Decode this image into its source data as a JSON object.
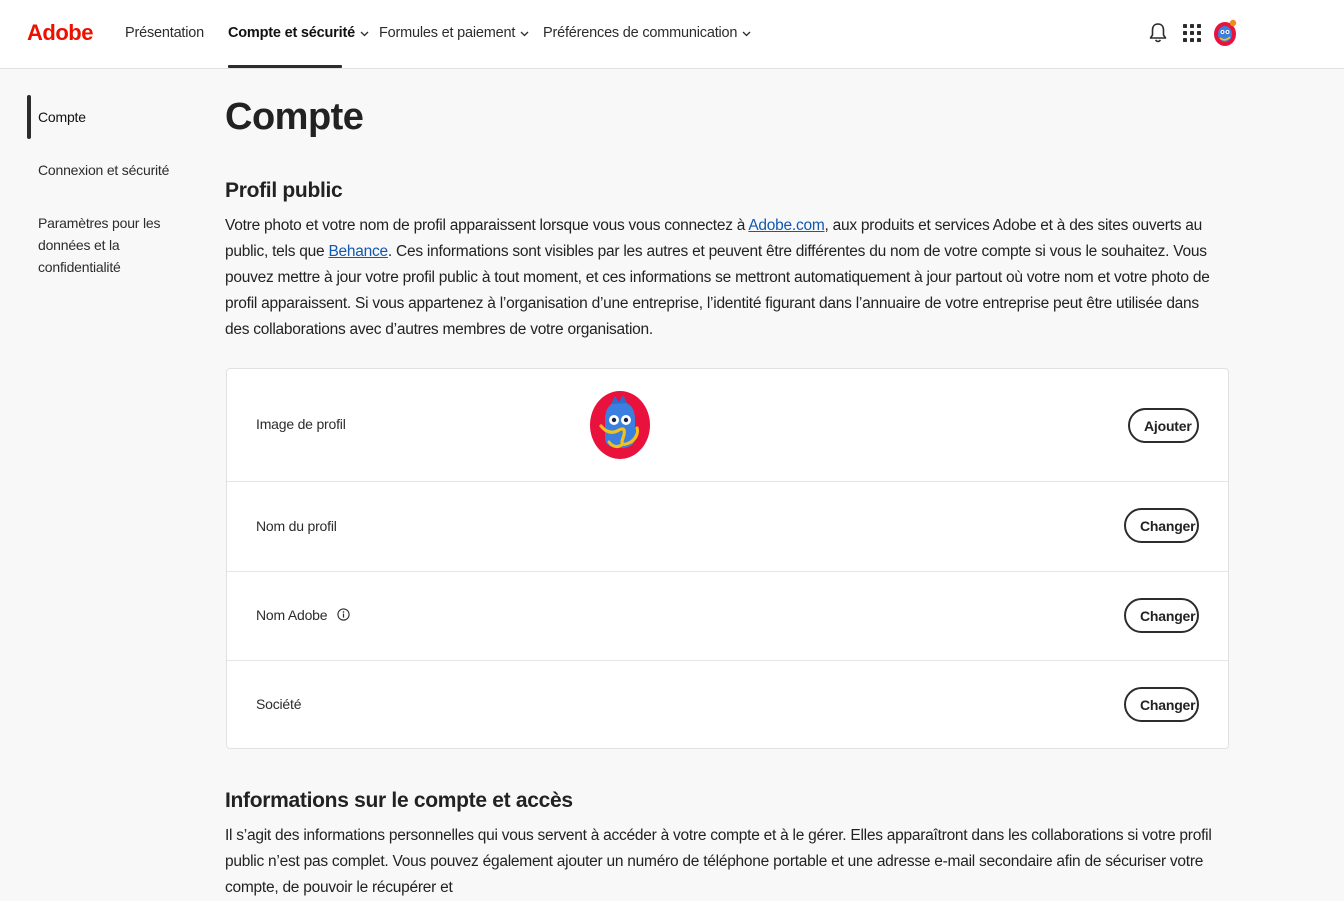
{
  "header": {
    "logo": "Adobe",
    "nav": [
      {
        "label": "Présentation",
        "active": false,
        "has_dropdown": false
      },
      {
        "label": "Compte et sécurité",
        "active": true,
        "has_dropdown": true
      },
      {
        "label": "Formules et paiement",
        "active": false,
        "has_dropdown": true
      },
      {
        "label": "Préférences de communication",
        "active": false,
        "has_dropdown": true
      }
    ],
    "icons": [
      "bell-icon",
      "apps-grid-icon",
      "user-avatar"
    ]
  },
  "sidebar": {
    "items": [
      {
        "label": "Compte",
        "active": true
      },
      {
        "label": "Connexion et sécurité",
        "active": false
      },
      {
        "label": "Paramètres pour les données et la confidentialité",
        "active": false
      }
    ]
  },
  "main": {
    "title": "Compte",
    "public_profile": {
      "heading": "Profil public",
      "text_1": "Votre photo et votre nom de profil apparaissent lorsque vous vous connectez à ",
      "link_1": "Adobe.com",
      "text_2": ", aux produits et services Adobe et à des sites ouverts au public, tels que ",
      "link_2": "Behance",
      "text_3": ". Ces informations sont visibles par les autres et peuvent être différentes du nom de votre compte si vous le souhaitez. Vous pouvez mettre à jour votre profil public à tout moment, et ces informations se mettront automatiquement à jour partout où votre nom et votre photo de profil apparaissent. Si vous appartenez à l’organisation d’une entreprise, l’identité figurant dans l’annuaire de votre entreprise peut être utilisée dans des collaborations avec d’autres membres de votre organisation."
    },
    "rows": [
      {
        "label": "Image de profil",
        "button": "Ajouter"
      },
      {
        "label": "Nom du profil",
        "button": "Changer"
      },
      {
        "label": "Nom Adobe",
        "button": "Changer"
      },
      {
        "label": "Société",
        "button": "Changer"
      }
    ],
    "account_info": {
      "heading": "Informations sur le compte et accès",
      "text": "Il s’agit des informations personnelles qui vous servent à accéder à votre compte et à le gérer. Elles apparaîtront dans les collaborations si votre profil public n’est pas complet. Vous pouvez également ajouter un numéro de téléphone portable et une adresse e-mail secondaire afin de sécuriser votre compte, de pouvoir le récupérer et"
    }
  },
  "colors": {
    "brand": "#eb1000",
    "link": "#1159b0",
    "text": "#222222"
  }
}
